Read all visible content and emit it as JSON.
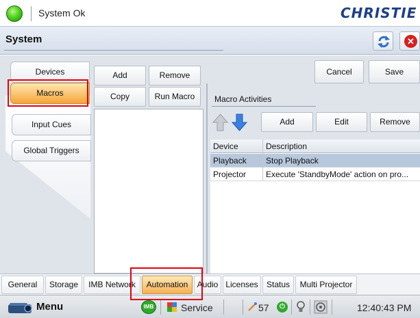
{
  "status": {
    "text": "System Ok",
    "led_color": "#3ec11a"
  },
  "brand": {
    "logo_text": "CHRISTIE"
  },
  "header": {
    "title": "System"
  },
  "side_tabs": [
    {
      "label": "Devices",
      "selected": false
    },
    {
      "label": "Macros",
      "selected": true
    },
    {
      "label": "Input Cues",
      "selected": false
    },
    {
      "label": "Global Triggers",
      "selected": false
    }
  ],
  "macro_toolbar": {
    "add": "Add",
    "remove": "Remove",
    "copy": "Copy",
    "run": "Run Macro"
  },
  "top_actions": {
    "cancel": "Cancel",
    "save": "Save"
  },
  "activities": {
    "section_label": "Macro Activities",
    "add": "Add",
    "edit": "Edit",
    "remove": "Remove",
    "columns": [
      "Device",
      "Description"
    ],
    "rows": [
      {
        "device": "Playback",
        "description": "Stop Playback",
        "selected": true
      },
      {
        "device": "Projector",
        "description": "Execute 'StandbyMode' action on pro...",
        "selected": false
      }
    ]
  },
  "bottom_tabs": [
    {
      "label": "General",
      "selected": false
    },
    {
      "label": "Storage",
      "selected": false
    },
    {
      "label": "IMB Network",
      "selected": false
    },
    {
      "label": "Automation",
      "selected": true
    },
    {
      "label": "Audio",
      "selected": false
    },
    {
      "label": "Licenses",
      "selected": false
    },
    {
      "label": "Status",
      "selected": false
    },
    {
      "label": "Multi Projector",
      "selected": false
    }
  ],
  "taskbar": {
    "menu": "Menu",
    "imb_badge": "IMB",
    "service": "Service",
    "counter": "57",
    "clock": "12:40:43 PM"
  },
  "colors": {
    "accent_orange": "#f5a43a",
    "highlight_red": "#e0000f",
    "brand_blue": "#1d3f8a"
  }
}
